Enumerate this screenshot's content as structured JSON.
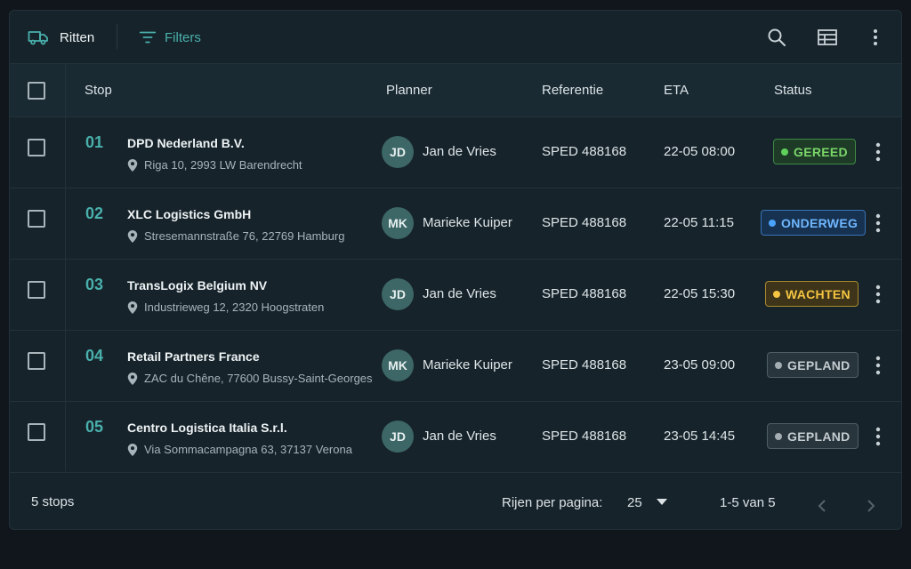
{
  "toolbar": {
    "title": "Ritten",
    "filters_label": "Filters",
    "icons": [
      "truck-icon",
      "filter-icon",
      "search-icon",
      "view-columns-icon",
      "more-vert-icon"
    ]
  },
  "table": {
    "columns": {
      "stop": "Stop",
      "planner": "Planner",
      "referentie": "Referentie",
      "eta": "ETA",
      "status": "Status"
    },
    "rows": [
      {
        "num": "01",
        "name": "DPD Nederland B.V.",
        "address": "Riga 10, 2993 LW Barendrecht",
        "initials": "JD",
        "planner": "Jan de Vries",
        "ref": "SPED 488168",
        "eta": "22-05 08:00",
        "status": "GEREED"
      },
      {
        "num": "02",
        "name": "XLC Logistics GmbH",
        "address": "Stresemannstraße 76, 22769 Hamburg",
        "initials": "MK",
        "planner": "Marieke Kuiper",
        "ref": "SPED 488168",
        "eta": "22-05 11:15",
        "status": "ONDERWEG"
      },
      {
        "num": "03",
        "name": "TransLogix Belgium NV",
        "address": "Industrieweg 12, 2320 Hoogstraten",
        "initials": "JD",
        "planner": "Jan de Vries",
        "ref": "SPED 488168",
        "eta": "22-05 15:30",
        "status": "WACHTEN"
      },
      {
        "num": "04",
        "name": "Retail Partners France",
        "address": "ZAC du Chêne, 77600 Bussy-Saint-Georges",
        "initials": "MK",
        "planner": "Marieke Kuiper",
        "ref": "SPED 488168",
        "eta": "23-05 09:00",
        "status": "GEPLAND"
      },
      {
        "num": "05",
        "name": "Centro Logistica Italia S.r.l.",
        "address": "Via Sommacampagna 63, 37137 Verona",
        "initials": "JD",
        "planner": "Jan de Vries",
        "ref": "SPED 488168",
        "eta": "23-05 14:45",
        "status": "GEPLAND"
      }
    ]
  },
  "status_colors": {
    "GEREED": {
      "fg": "#7bd66a",
      "bg": "#1d3b27",
      "border": "#3f8a44",
      "dot": "#5fd15a"
    },
    "ONDERWEG": {
      "fg": "#6fb7ff",
      "bg": "#173250",
      "border": "#3874b8",
      "dot": "#4aa3ff"
    },
    "WACHTEN": {
      "fg": "#f4c542",
      "bg": "#3d3419",
      "border": "#a88a2c",
      "dot": "#f4c542"
    },
    "GEPLAND": {
      "fg": "#c4ccd0",
      "bg": "#28353c",
      "border": "#4f5e66",
      "dot": "#a3adb2"
    }
  },
  "footer": {
    "count": "5 stops",
    "rows_per_page_label": "Rijen per pagina:",
    "rows_per_page_value": "25",
    "range": "1-5 van 5"
  },
  "colors": {
    "accent": "#49b0ac",
    "background": "#10161b",
    "surface": "#16232a"
  }
}
